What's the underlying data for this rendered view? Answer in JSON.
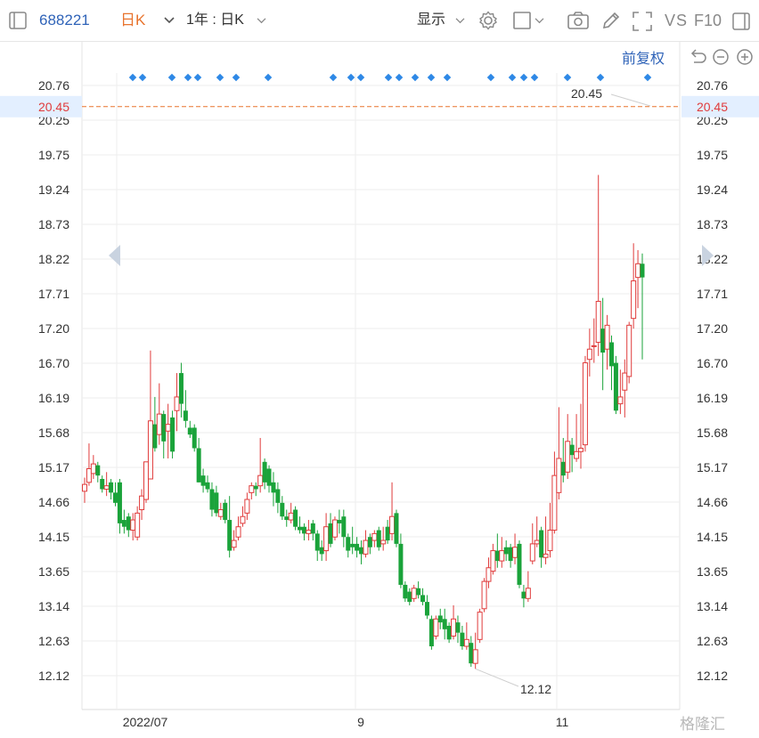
{
  "toolbar": {
    "ticker": "688221",
    "period": "日K",
    "range": "1年 : 日K",
    "display": "显示",
    "vs": "VS",
    "f10": "F10",
    "adjust": "前复权"
  },
  "colors": {
    "up": "#e03b3b",
    "down": "#1aa33a",
    "price_line": "#e8732d",
    "marker": "#2e88e6",
    "grid": "#eeeeee"
  },
  "watermark": "格隆汇",
  "chart_data": {
    "type": "candlestick",
    "y_ticks": [
      "20.76",
      "20.25",
      "19.75",
      "19.24",
      "18.73",
      "18.22",
      "17.71",
      "17.20",
      "16.70",
      "16.19",
      "15.68",
      "15.17",
      "14.66",
      "14.15",
      "13.65",
      "13.14",
      "12.63",
      "12.12"
    ],
    "ylim": [
      12.12,
      20.76
    ],
    "x_labels": [
      "2022/07",
      "9",
      "11"
    ],
    "current_price": "20.45",
    "annotations": {
      "high_label": "20.45",
      "low_label": "12.12"
    },
    "candles": [
      [
        14.82,
        14.92,
        14.65,
        15.02
      ],
      [
        14.95,
        15.15,
        14.9,
        15.52
      ],
      [
        15.08,
        15.22,
        15.0,
        15.35
      ],
      [
        15.2,
        15.05,
        14.95,
        15.25
      ],
      [
        15.0,
        14.85,
        14.8,
        15.05
      ],
      [
        14.85,
        14.9,
        14.75,
        15.1
      ],
      [
        14.95,
        14.8,
        14.7,
        15.0
      ],
      [
        14.8,
        14.65,
        14.6,
        14.95
      ],
      [
        14.95,
        14.35,
        14.2,
        15.0
      ],
      [
        14.4,
        14.3,
        14.2,
        14.55
      ],
      [
        14.45,
        14.25,
        14.15,
        14.5
      ],
      [
        14.25,
        14.4,
        14.1,
        14.5
      ],
      [
        14.15,
        14.5,
        14.1,
        14.6
      ],
      [
        14.55,
        14.75,
        14.4,
        14.85
      ],
      [
        14.7,
        15.25,
        14.65,
        15.25
      ],
      [
        15.0,
        15.85,
        15.0,
        16.88
      ],
      [
        15.8,
        15.45,
        15.4,
        16.2
      ],
      [
        15.65,
        15.95,
        15.5,
        16.4
      ],
      [
        15.95,
        15.55,
        15.3,
        16.0
      ],
      [
        15.7,
        15.8,
        15.3,
        16.1
      ],
      [
        15.9,
        15.4,
        15.3,
        16.0
      ],
      [
        16.0,
        16.2,
        15.7,
        16.55
      ],
      [
        16.55,
        16.1,
        15.9,
        16.7
      ],
      [
        16.0,
        15.85,
        15.75,
        16.3
      ],
      [
        15.75,
        15.65,
        15.6,
        15.85
      ],
      [
        15.75,
        15.45,
        15.4,
        15.8
      ],
      [
        15.45,
        14.95,
        14.95,
        15.6
      ],
      [
        15.05,
        14.9,
        14.8,
        15.15
      ],
      [
        14.95,
        14.85,
        14.8,
        15.05
      ],
      [
        14.85,
        14.55,
        14.45,
        14.95
      ],
      [
        14.8,
        14.5,
        14.45,
        14.9
      ],
      [
        14.45,
        14.55,
        14.4,
        14.65
      ],
      [
        14.65,
        14.4,
        14.35,
        14.7
      ],
      [
        14.4,
        13.95,
        13.85,
        14.75
      ],
      [
        14.0,
        14.1,
        13.95,
        14.25
      ],
      [
        14.15,
        14.3,
        14.1,
        14.45
      ],
      [
        14.35,
        14.45,
        14.3,
        14.6
      ],
      [
        14.5,
        14.7,
        14.4,
        14.8
      ],
      [
        14.8,
        14.9,
        14.7,
        14.95
      ],
      [
        14.9,
        14.85,
        14.75,
        14.95
      ],
      [
        14.9,
        15.05,
        14.8,
        15.6
      ],
      [
        15.25,
        14.95,
        14.85,
        15.3
      ],
      [
        15.15,
        14.9,
        14.8,
        15.2
      ],
      [
        14.95,
        14.8,
        14.6,
        15.1
      ],
      [
        14.85,
        14.65,
        14.5,
        14.95
      ],
      [
        14.65,
        14.45,
        14.4,
        14.75
      ],
      [
        14.45,
        14.4,
        14.3,
        14.55
      ],
      [
        14.4,
        14.5,
        14.35,
        14.65
      ],
      [
        14.55,
        14.3,
        14.25,
        14.6
      ],
      [
        14.3,
        14.25,
        14.2,
        14.45
      ],
      [
        14.3,
        14.2,
        14.1,
        14.35
      ],
      [
        14.2,
        14.25,
        14.1,
        14.4
      ],
      [
        14.35,
        14.2,
        14.1,
        14.4
      ],
      [
        14.2,
        13.95,
        13.8,
        14.25
      ],
      [
        14.0,
        13.9,
        13.8,
        14.1
      ],
      [
        13.95,
        14.3,
        13.8,
        14.5
      ],
      [
        14.35,
        14.05,
        14.0,
        14.5
      ],
      [
        14.15,
        14.4,
        14.1,
        14.45
      ],
      [
        14.4,
        14.35,
        14.2,
        14.55
      ],
      [
        14.45,
        14.15,
        14.0,
        14.55
      ],
      [
        14.15,
        13.95,
        13.85,
        14.2
      ],
      [
        14.05,
        14.0,
        13.9,
        14.3
      ],
      [
        14.05,
        13.95,
        13.85,
        14.15
      ],
      [
        14.0,
        13.9,
        13.75,
        14.1
      ],
      [
        13.9,
        14.1,
        13.85,
        14.25
      ],
      [
        14.15,
        14.0,
        13.9,
        14.2
      ],
      [
        14.1,
        14.2,
        14.0,
        14.25
      ],
      [
        14.25,
        14.0,
        13.95,
        14.3
      ],
      [
        14.05,
        14.1,
        13.95,
        14.3
      ],
      [
        14.3,
        14.1,
        14.05,
        14.4
      ],
      [
        14.2,
        14.45,
        14.1,
        14.95
      ],
      [
        14.5,
        14.05,
        14.0,
        14.55
      ],
      [
        14.05,
        13.45,
        13.4,
        14.2
      ],
      [
        13.45,
        13.25,
        13.2,
        13.5
      ],
      [
        13.35,
        13.2,
        13.15,
        13.4
      ],
      [
        13.25,
        13.4,
        13.2,
        13.45
      ],
      [
        13.4,
        13.3,
        13.25,
        13.5
      ],
      [
        13.3,
        13.2,
        13.15,
        13.4
      ],
      [
        13.2,
        13.0,
        12.95,
        13.3
      ],
      [
        12.95,
        12.55,
        12.5,
        13.0
      ],
      [
        12.7,
        12.95,
        12.65,
        13.0
      ],
      [
        13.0,
        12.9,
        12.8,
        13.1
      ],
      [
        12.95,
        12.8,
        12.65,
        13.1
      ],
      [
        12.85,
        12.65,
        12.6,
        12.9
      ],
      [
        12.7,
        12.95,
        12.65,
        13.15
      ],
      [
        12.9,
        12.75,
        12.6,
        13.0
      ],
      [
        12.75,
        12.55,
        12.5,
        12.85
      ],
      [
        12.55,
        12.65,
        12.5,
        12.9
      ],
      [
        12.6,
        12.3,
        12.25,
        12.7
      ],
      [
        12.3,
        12.5,
        12.22,
        12.75
      ],
      [
        12.65,
        13.05,
        12.6,
        13.1
      ],
      [
        13.1,
        13.5,
        13.05,
        13.55
      ],
      [
        13.5,
        13.7,
        13.4,
        13.85
      ],
      [
        13.65,
        13.95,
        13.6,
        14.05
      ],
      [
        13.95,
        13.8,
        13.7,
        14.2
      ],
      [
        13.8,
        13.95,
        13.7,
        14.15
      ],
      [
        14.0,
        13.9,
        13.8,
        14.1
      ],
      [
        14.0,
        13.8,
        13.7,
        14.05
      ],
      [
        13.85,
        14.0,
        13.75,
        14.2
      ],
      [
        14.05,
        13.45,
        13.4,
        14.1
      ],
      [
        13.35,
        13.25,
        13.12,
        13.45
      ],
      [
        13.25,
        13.4,
        13.2,
        13.65
      ],
      [
        13.8,
        14.05,
        13.75,
        14.35
      ],
      [
        14.05,
        14.1,
        14.0,
        14.45
      ],
      [
        14.25,
        13.85,
        13.7,
        14.3
      ],
      [
        13.85,
        13.9,
        13.75,
        14.45
      ],
      [
        13.95,
        14.25,
        13.85,
        14.65
      ],
      [
        14.25,
        15.05,
        14.2,
        15.4
      ],
      [
        14.8,
        15.3,
        14.7,
        16.05
      ],
      [
        15.25,
        15.05,
        14.95,
        15.6
      ],
      [
        15.1,
        15.55,
        15.0,
        15.95
      ],
      [
        15.5,
        15.35,
        15.1,
        15.6
      ],
      [
        15.3,
        15.4,
        15.25,
        15.95
      ],
      [
        15.4,
        15.45,
        15.15,
        16.1
      ],
      [
        15.5,
        16.7,
        15.4,
        16.8
      ],
      [
        16.75,
        16.9,
        16.5,
        17.2
      ],
      [
        16.95,
        16.95,
        16.7,
        17.35
      ],
      [
        17.0,
        17.6,
        16.8,
        19.45
      ],
      [
        17.2,
        16.85,
        16.3,
        17.65
      ],
      [
        16.9,
        17.25,
        16.6,
        17.4
      ],
      [
        17.0,
        16.65,
        16.3,
        17.1
      ],
      [
        16.7,
        16.0,
        15.95,
        16.8
      ],
      [
        16.1,
        16.2,
        15.95,
        16.6
      ],
      [
        16.3,
        16.55,
        15.9,
        16.75
      ],
      [
        16.5,
        17.25,
        16.4,
        17.3
      ],
      [
        17.35,
        17.9,
        17.2,
        18.45
      ],
      [
        17.95,
        18.15,
        17.5,
        18.35
      ],
      [
        18.15,
        17.95,
        16.75,
        18.3
      ]
    ]
  }
}
